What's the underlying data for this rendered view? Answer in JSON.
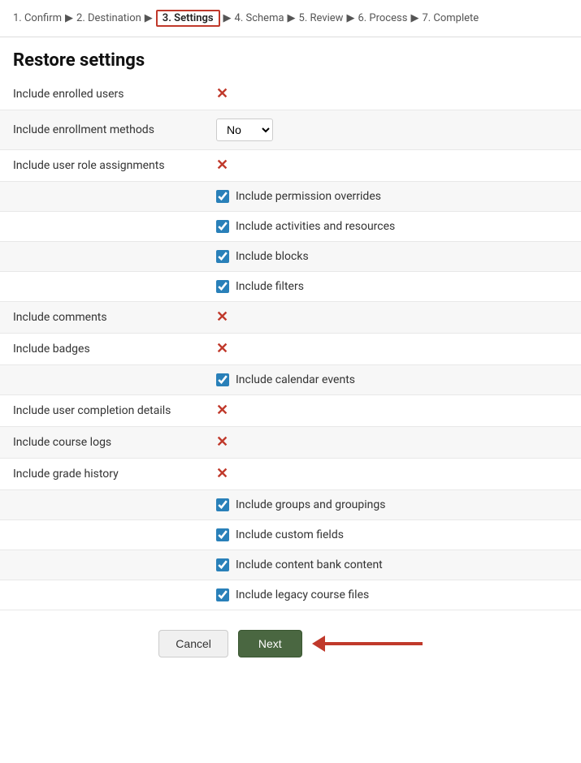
{
  "breadcrumb": {
    "steps": [
      {
        "label": "1. Confirm",
        "active": false
      },
      {
        "label": "2. Destination",
        "active": false
      },
      {
        "label": "3. Settings",
        "active": true
      },
      {
        "label": "4. Schema",
        "active": false
      },
      {
        "label": "5. Review",
        "active": false
      },
      {
        "label": "6. Process",
        "active": false
      },
      {
        "label": "7. Complete",
        "active": false
      }
    ]
  },
  "page": {
    "title": "Restore settings"
  },
  "settings": [
    {
      "type": "x-mark",
      "label": "Include enrolled users",
      "indented": false
    },
    {
      "type": "select",
      "label": "Include enrollment methods",
      "value": "No",
      "indented": false
    },
    {
      "type": "x-mark",
      "label": "Include user role assignments",
      "indented": false
    },
    {
      "type": "checkbox",
      "label": "Include permission overrides",
      "checked": true,
      "indented": true
    },
    {
      "type": "checkbox",
      "label": "Include activities and resources",
      "checked": true,
      "indented": true
    },
    {
      "type": "checkbox",
      "label": "Include blocks",
      "checked": true,
      "indented": true
    },
    {
      "type": "checkbox",
      "label": "Include filters",
      "checked": true,
      "indented": true
    },
    {
      "type": "x-mark",
      "label": "Include comments",
      "indented": false
    },
    {
      "type": "x-mark",
      "label": "Include badges",
      "indented": false
    },
    {
      "type": "checkbox",
      "label": "Include calendar events",
      "checked": true,
      "indented": true
    },
    {
      "type": "x-mark",
      "label": "Include user completion details",
      "indented": false
    },
    {
      "type": "x-mark",
      "label": "Include course logs",
      "indented": false
    },
    {
      "type": "x-mark",
      "label": "Include grade history",
      "indented": false
    },
    {
      "type": "checkbox",
      "label": "Include groups and groupings",
      "checked": true,
      "indented": true
    },
    {
      "type": "checkbox",
      "label": "Include custom fields",
      "checked": true,
      "indented": true
    },
    {
      "type": "checkbox",
      "label": "Include content bank content",
      "checked": true,
      "indented": true
    },
    {
      "type": "checkbox",
      "label": "Include legacy course files",
      "checked": true,
      "indented": true
    }
  ],
  "footer": {
    "cancel_label": "Cancel",
    "next_label": "Next"
  }
}
